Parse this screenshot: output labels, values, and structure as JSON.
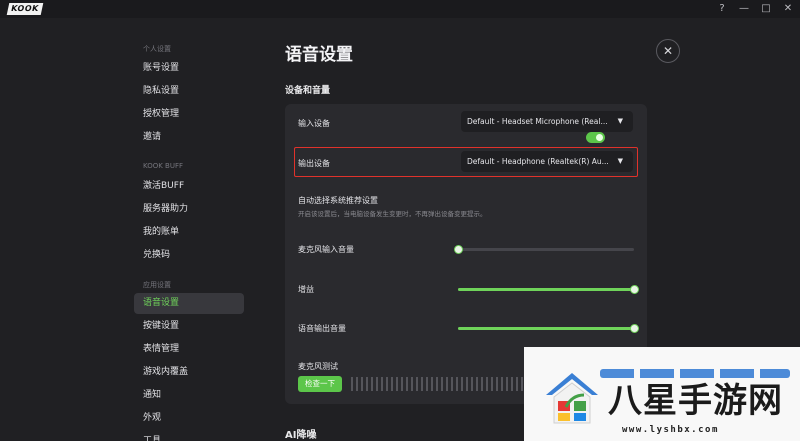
{
  "titlebar": {
    "logo": "KOOK",
    "buttons": [
      {
        "name": "help-icon",
        "glyph": "?"
      },
      {
        "name": "minimize-icon",
        "glyph": "—"
      },
      {
        "name": "maximize-icon",
        "glyph": "□"
      },
      {
        "name": "close-window-icon",
        "glyph": "✕"
      }
    ]
  },
  "sidebar": {
    "sections": {
      "personal": "个人设置",
      "kookbuff": "KOOK BUFF",
      "app": "应用设置"
    },
    "items": [
      {
        "label": "账号设置"
      },
      {
        "label": "隐私设置"
      },
      {
        "label": "授权管理"
      },
      {
        "label": "邀请"
      },
      {
        "label": "激活BUFF"
      },
      {
        "label": "服务器助力"
      },
      {
        "label": "我的账单"
      },
      {
        "label": "兑换码"
      },
      {
        "label": "语音设置",
        "active": true
      },
      {
        "label": "按键设置"
      },
      {
        "label": "表情管理"
      },
      {
        "label": "游戏内覆盖"
      },
      {
        "label": "通知"
      },
      {
        "label": "外观"
      },
      {
        "label": "工具"
      }
    ]
  },
  "main": {
    "title": "语音设置",
    "close_glyph": "✕",
    "section_devices": "设备和音量",
    "section_ai": "AI降噪",
    "input_device": {
      "label": "输入设备",
      "value": "Default - Headset Microphone (Real..."
    },
    "output_device": {
      "label": "输出设备",
      "value": "Default - Headphone (Realtek(R) Au..."
    },
    "auto_select": {
      "label": "自动选择系统推荐设置",
      "desc": "开启该设置后，当电脑设备发生变更时，不再弹出设备变更提示。",
      "enabled": true
    },
    "mic_volume": {
      "label": "麦克风输入音量",
      "value": 0
    },
    "noise_gate": {
      "label": "增益",
      "value": 100
    },
    "output_volume": {
      "label": "语音输出音量",
      "value": 100
    },
    "mic_test": {
      "label": "麦克风测试",
      "button": "检查一下"
    },
    "caret_glyph": "▼"
  },
  "watermark": {
    "text": "八星手游网",
    "url": "www.lyshbx.com"
  },
  "colors": {
    "accent": "#6fd35a",
    "highlight": "#e0322b",
    "background": "#202023",
    "panel": "#2a2a2e"
  }
}
